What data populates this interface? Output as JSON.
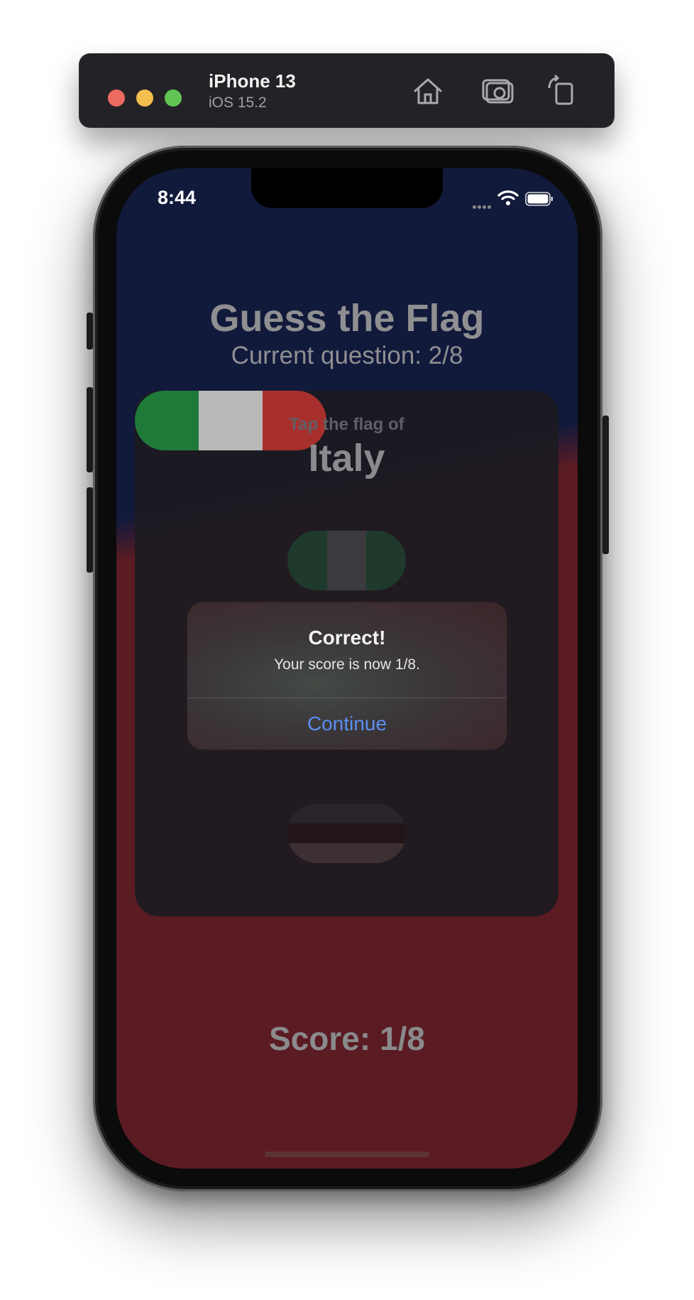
{
  "simulator": {
    "device_name": "iPhone 13",
    "os_version": "iOS 15.2",
    "buttons": [
      "home-icon",
      "screenshot-icon",
      "rotate-icon"
    ]
  },
  "status_bar": {
    "time": "8:44",
    "icons": [
      "cellular-dots-icon",
      "wifi-icon",
      "battery-icon"
    ]
  },
  "app": {
    "title": "Guess the Flag",
    "current_question": "Current question: 2/8",
    "prompt": "Tap the flag of",
    "country": "Italy",
    "score": "Score: 1/8",
    "colors": {
      "top_background": "#111a3b",
      "bottom_background": "#5b1b23"
    }
  },
  "flags": [
    {
      "name": "flag-option-1",
      "stripes": [
        "#1f3a2c",
        "#3a3a3f",
        "#1f3a2c"
      ],
      "orientation": "vertical"
    },
    {
      "name": "flag-option-2",
      "stripes": [
        "#1f7a3a",
        "#b9b9b9",
        "#a8302c"
      ],
      "orientation": "vertical"
    },
    {
      "name": "flag-option-3",
      "stripes": [
        "#2a2329",
        "#231619",
        "#3d3033"
      ],
      "orientation": "horizontal"
    }
  ],
  "alert": {
    "title": "Correct!",
    "message": "Your score is now 1/8.",
    "button_label": "Continue",
    "button_color": "#5a8ff0"
  }
}
